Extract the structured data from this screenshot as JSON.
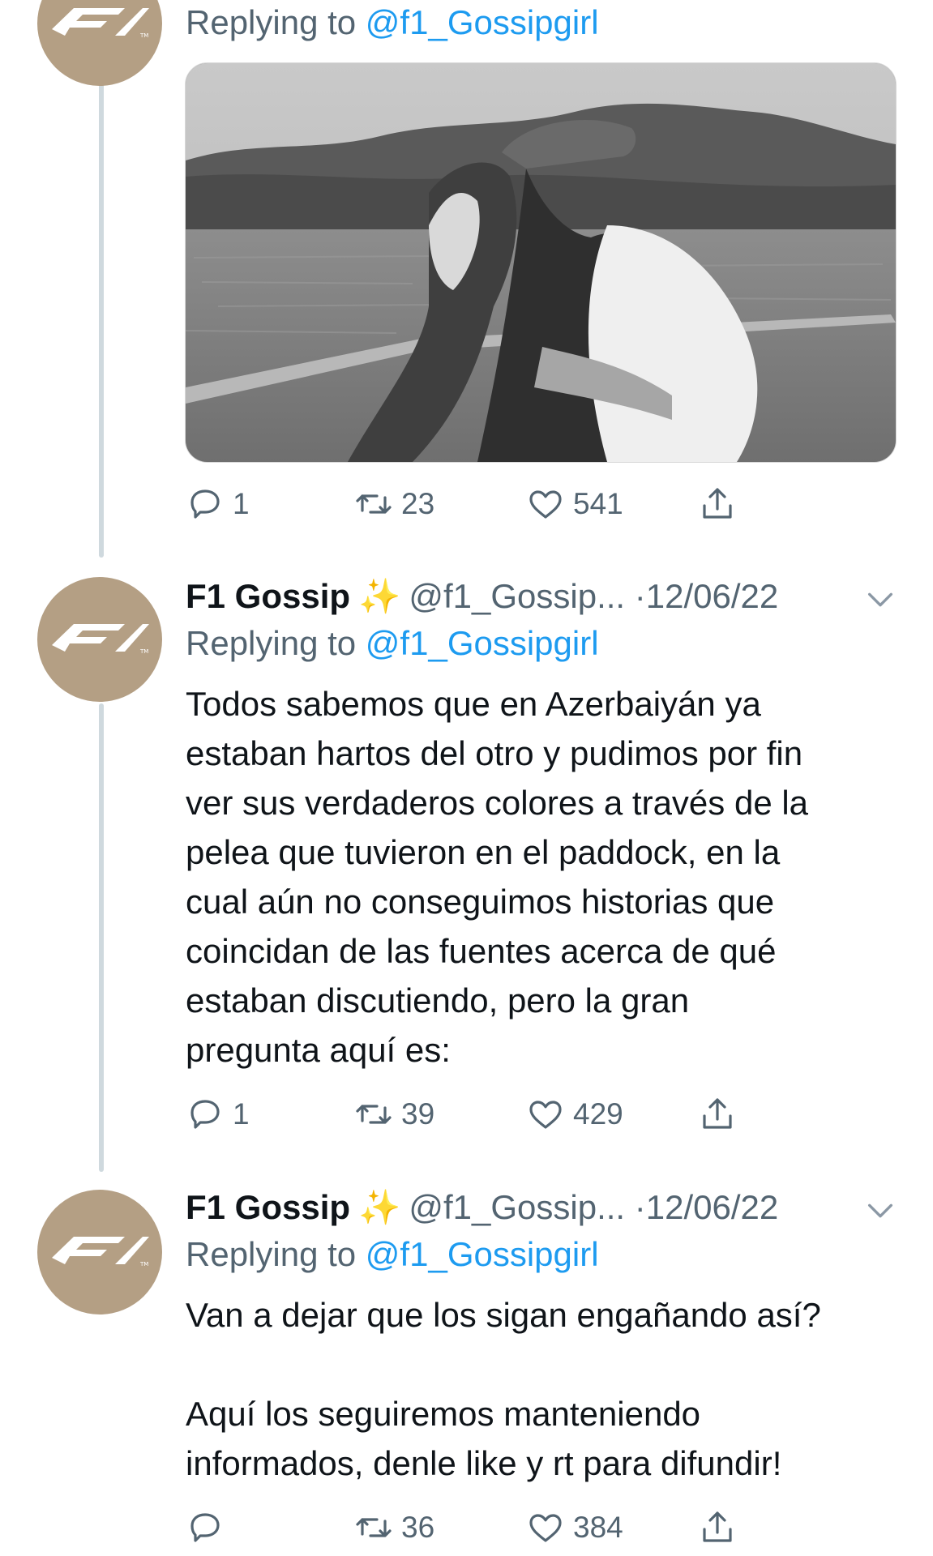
{
  "tweets": [
    {
      "reply_prefix": "Replying to",
      "reply_handle": "@f1_Gossipgirl",
      "avatar_icon": "f1-logo-icon",
      "actions": {
        "reply": "1",
        "retweet": "23",
        "like": "541"
      }
    },
    {
      "name": "F1 Gossip",
      "sparkle": "✨",
      "handle": "@f1_Gossip...",
      "date": "·12/06/22",
      "reply_prefix": "Replying to",
      "reply_handle": "@f1_Gossipgirl",
      "text": "Todos sabemos que en Azerbaiyán ya\nestaban hartos del otro y pudimos por fin\nver sus verdaderos colores a través de la\npelea que tuvieron en el paddock, en la\ncual aún no conseguimos historias que\ncoincidan de las fuentes acerca de qué\nestaban discutiendo, pero la gran\npregunta aquí es:",
      "actions": {
        "reply": "1",
        "retweet": "39",
        "like": "429"
      }
    },
    {
      "name": "F1 Gossip",
      "sparkle": "✨",
      "handle": "@f1_Gossip...",
      "date": "·12/06/22",
      "reply_prefix": "Replying to",
      "reply_handle": "@f1_Gossipgirl",
      "text": "Van a dejar que los sigan engañando así?\n\nAquí los seguiremos manteniendo\ninformados, denle like y rt para difundir!",
      "actions": {
        "reply": "",
        "retweet": "36",
        "like": "384"
      }
    }
  ],
  "colors": {
    "accent": "#1d9bf0",
    "muted": "#536471",
    "avatar_bg": "#b49f84",
    "line": "#cfd9de"
  }
}
